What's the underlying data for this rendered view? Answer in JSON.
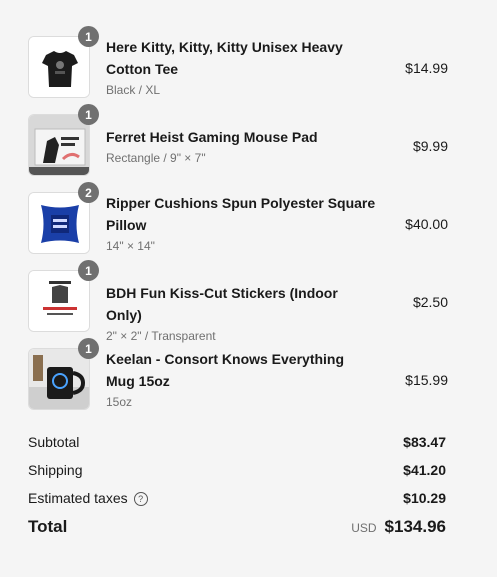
{
  "items": [
    {
      "qty": "1",
      "title": "Here Kitty, Kitty, Kitty Unisex Heavy Cotton Tee",
      "variant": "Black / XL",
      "price": "$14.99"
    },
    {
      "qty": "1",
      "title": "Ferret Heist Gaming Mouse Pad",
      "variant": "Rectangle / 9\" × 7\"",
      "price": "$9.99"
    },
    {
      "qty": "2",
      "title": "Ripper Cushions Spun Polyester Square Pillow",
      "variant": "14\" × 14\"",
      "price": "$40.00"
    },
    {
      "qty": "1",
      "title": "BDH Fun Kiss-Cut Stickers (Indoor Only)",
      "variant": "2\" × 2\" / Transparent",
      "price": "$2.50"
    },
    {
      "qty": "1",
      "title": "Keelan - Consort Knows Everything Mug 15oz",
      "variant": "15oz",
      "price": "$15.99"
    }
  ],
  "summary": {
    "subtotal_label": "Subtotal",
    "subtotal_value": "$83.47",
    "shipping_label": "Shipping",
    "shipping_value": "$41.20",
    "taxes_label": "Estimated taxes",
    "taxes_value": "$10.29",
    "taxes_help_icon": "question-circle-icon",
    "total_label": "Total",
    "currency": "USD",
    "total_value": "$134.96"
  }
}
